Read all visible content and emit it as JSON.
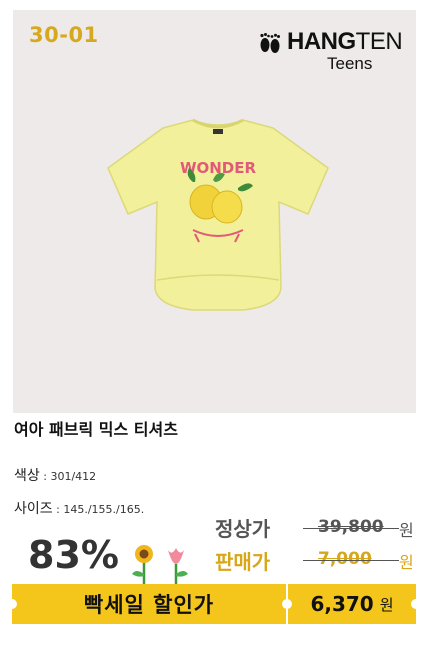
{
  "badge": {
    "code": "30-01"
  },
  "brand": {
    "name_bold": "HANG",
    "name_thin": "TEN",
    "sub": "Teens"
  },
  "shirt": {
    "print_word": "WONDER",
    "color": "#f2f09a"
  },
  "product": {
    "name": "여아 패브릭 믹스 티셔츠"
  },
  "details": {
    "color_label": "색상",
    "color_sep": " : ",
    "color_values": "301/412",
    "size_label": "사이즈",
    "size_sep": " : ",
    "size_values": "145./155./165."
  },
  "pricing": {
    "discount": "83%",
    "regular_label": "정상가",
    "regular_price": "39,800",
    "sale_label": "판매가",
    "sale_price": "7,000",
    "currency": "원"
  },
  "banner": {
    "title": "빡세일 할인가",
    "final_price": "6,370",
    "currency": "원"
  },
  "colors": {
    "accent": "#f4c51a",
    "badge": "#d6a81d",
    "photo_bg": "#efeaea"
  }
}
